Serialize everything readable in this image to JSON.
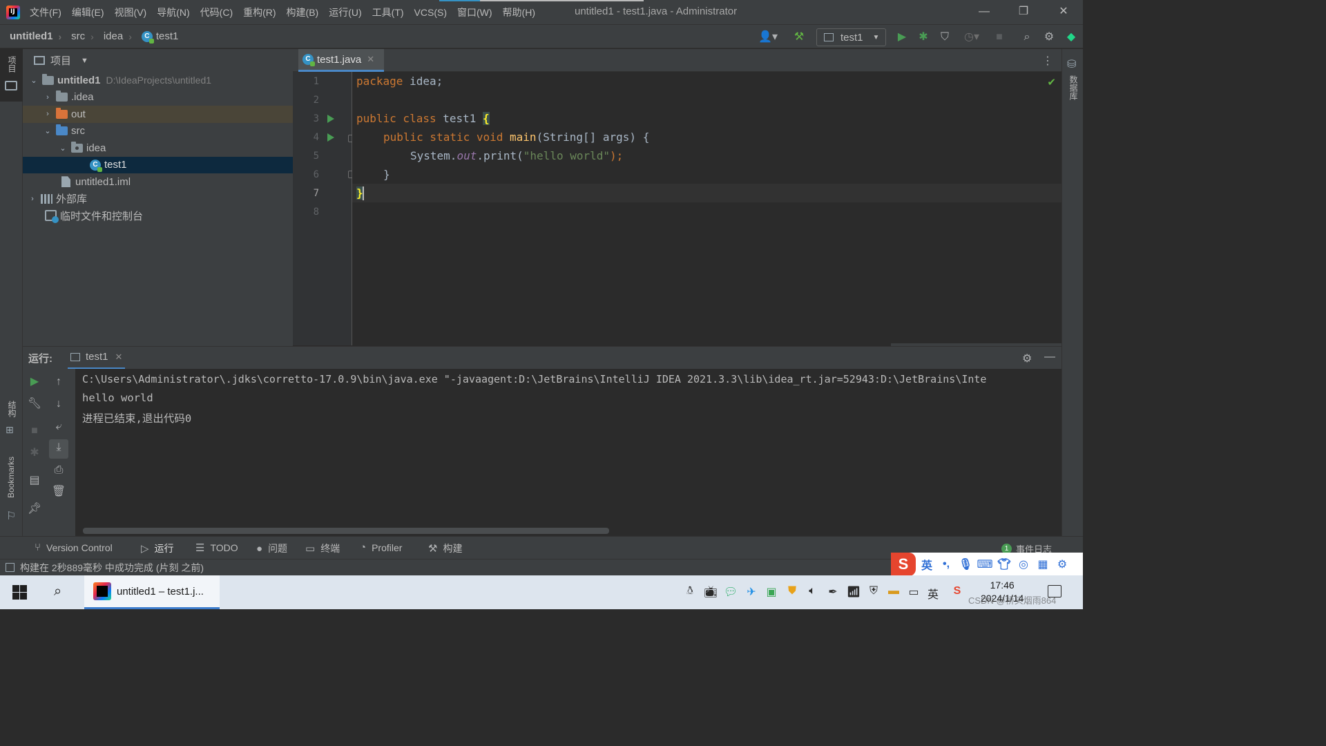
{
  "titlebar": {
    "menu": [
      "文件(F)",
      "编辑(E)",
      "视图(V)",
      "导航(N)",
      "代码(C)",
      "重构(R)",
      "构建(B)",
      "运行(U)",
      "工具(T)",
      "VCS(S)",
      "窗口(W)",
      "帮助(H)"
    ],
    "window_title": "untitled1 - test1.java - Administrator",
    "controls": {
      "minimize": "—",
      "restore": "❐",
      "close": "✕"
    }
  },
  "navbar": {
    "breadcrumbs": [
      "untitled1",
      "src",
      "idea",
      "test1"
    ],
    "run_config": "test1",
    "icons": [
      "user-icon",
      "build-hammer-icon",
      "run-icon",
      "debug-icon",
      "coverage-icon",
      "profile-icon",
      "stop-icon",
      "search-icon",
      "settings-icon",
      "toolbox-icon"
    ]
  },
  "left_strip": {
    "project_label": "项目",
    "structure_label": "结构",
    "bookmarks_label": "Bookmarks"
  },
  "right_strip": {
    "database_label": "数据库"
  },
  "project_panel": {
    "title": "项目",
    "tree": [
      {
        "label": "untitled1",
        "hint": "D:\\IdeaProjects\\untitled1",
        "depth": 0,
        "expanded": true,
        "icon": "module-folder-icon"
      },
      {
        "label": ".idea",
        "depth": 1,
        "expanded": false,
        "icon": "folder-icon"
      },
      {
        "label": "out",
        "depth": 1,
        "expanded": false,
        "icon": "excluded-folder-icon"
      },
      {
        "label": "src",
        "depth": 1,
        "expanded": true,
        "icon": "source-folder-icon"
      },
      {
        "label": "idea",
        "depth": 2,
        "expanded": true,
        "icon": "package-icon"
      },
      {
        "label": "test1",
        "depth": 3,
        "icon": "java-class-icon",
        "selected": true
      },
      {
        "label": "untitled1.iml",
        "depth": 2,
        "icon": "iml-file-icon"
      },
      {
        "label": "外部库",
        "depth": 0,
        "expanded": false,
        "icon": "library-icon"
      },
      {
        "label": "临时文件和控制台",
        "depth": 0,
        "icon": "scratch-icon"
      }
    ]
  },
  "editor": {
    "tab_label": "test1.java",
    "line_numbers": [
      "1",
      "2",
      "3",
      "4",
      "5",
      "6",
      "7",
      "8"
    ],
    "current_line": "7",
    "code": {
      "l1_kw": "package",
      "l1_rest": " idea;",
      "l3_kw": "public class",
      "l3_name": " test1 ",
      "l3_brace": "{",
      "l4_kw": "public static void",
      "l4_fn": "main",
      "l4_rest": "(String[] args) {",
      "l5_pre": "System.",
      "l5_field": "out",
      "l5_mid": ".print(",
      "l5_str": "\"hello world\"",
      "l5_end": ");",
      "l6": "}",
      "l7": "}"
    }
  },
  "run_panel": {
    "title": "运行:",
    "tab_label": "test1",
    "console": [
      "C:\\Users\\Administrator\\.jdks\\corretto-17.0.9\\bin\\java.exe \"-javaagent:D:\\JetBrains\\IntelliJ IDEA 2021.3.3\\lib\\idea_rt.jar=52943:D:\\JetBrains\\Inte",
      "hello world",
      "进程已结束,退出代码0"
    ]
  },
  "toolwindows": {
    "items": [
      "Version Control",
      "运行",
      "TODO",
      "问题",
      "终端",
      "Profiler",
      "构建"
    ],
    "event_log": "事件日志",
    "event_count": "1"
  },
  "statusbar": {
    "text": "构建在 2秒889毫秒 中成功完成 (片刻 之前)"
  },
  "ime": {
    "logo": "S",
    "lang": "英",
    "punct": "•,"
  },
  "taskbar": {
    "active_app": "untitled1 – test1.j...",
    "tray_lang": "英",
    "time": "17:46",
    "date": "2024/1/14"
  },
  "watermark": "CSDN @桥头烟雨864"
}
